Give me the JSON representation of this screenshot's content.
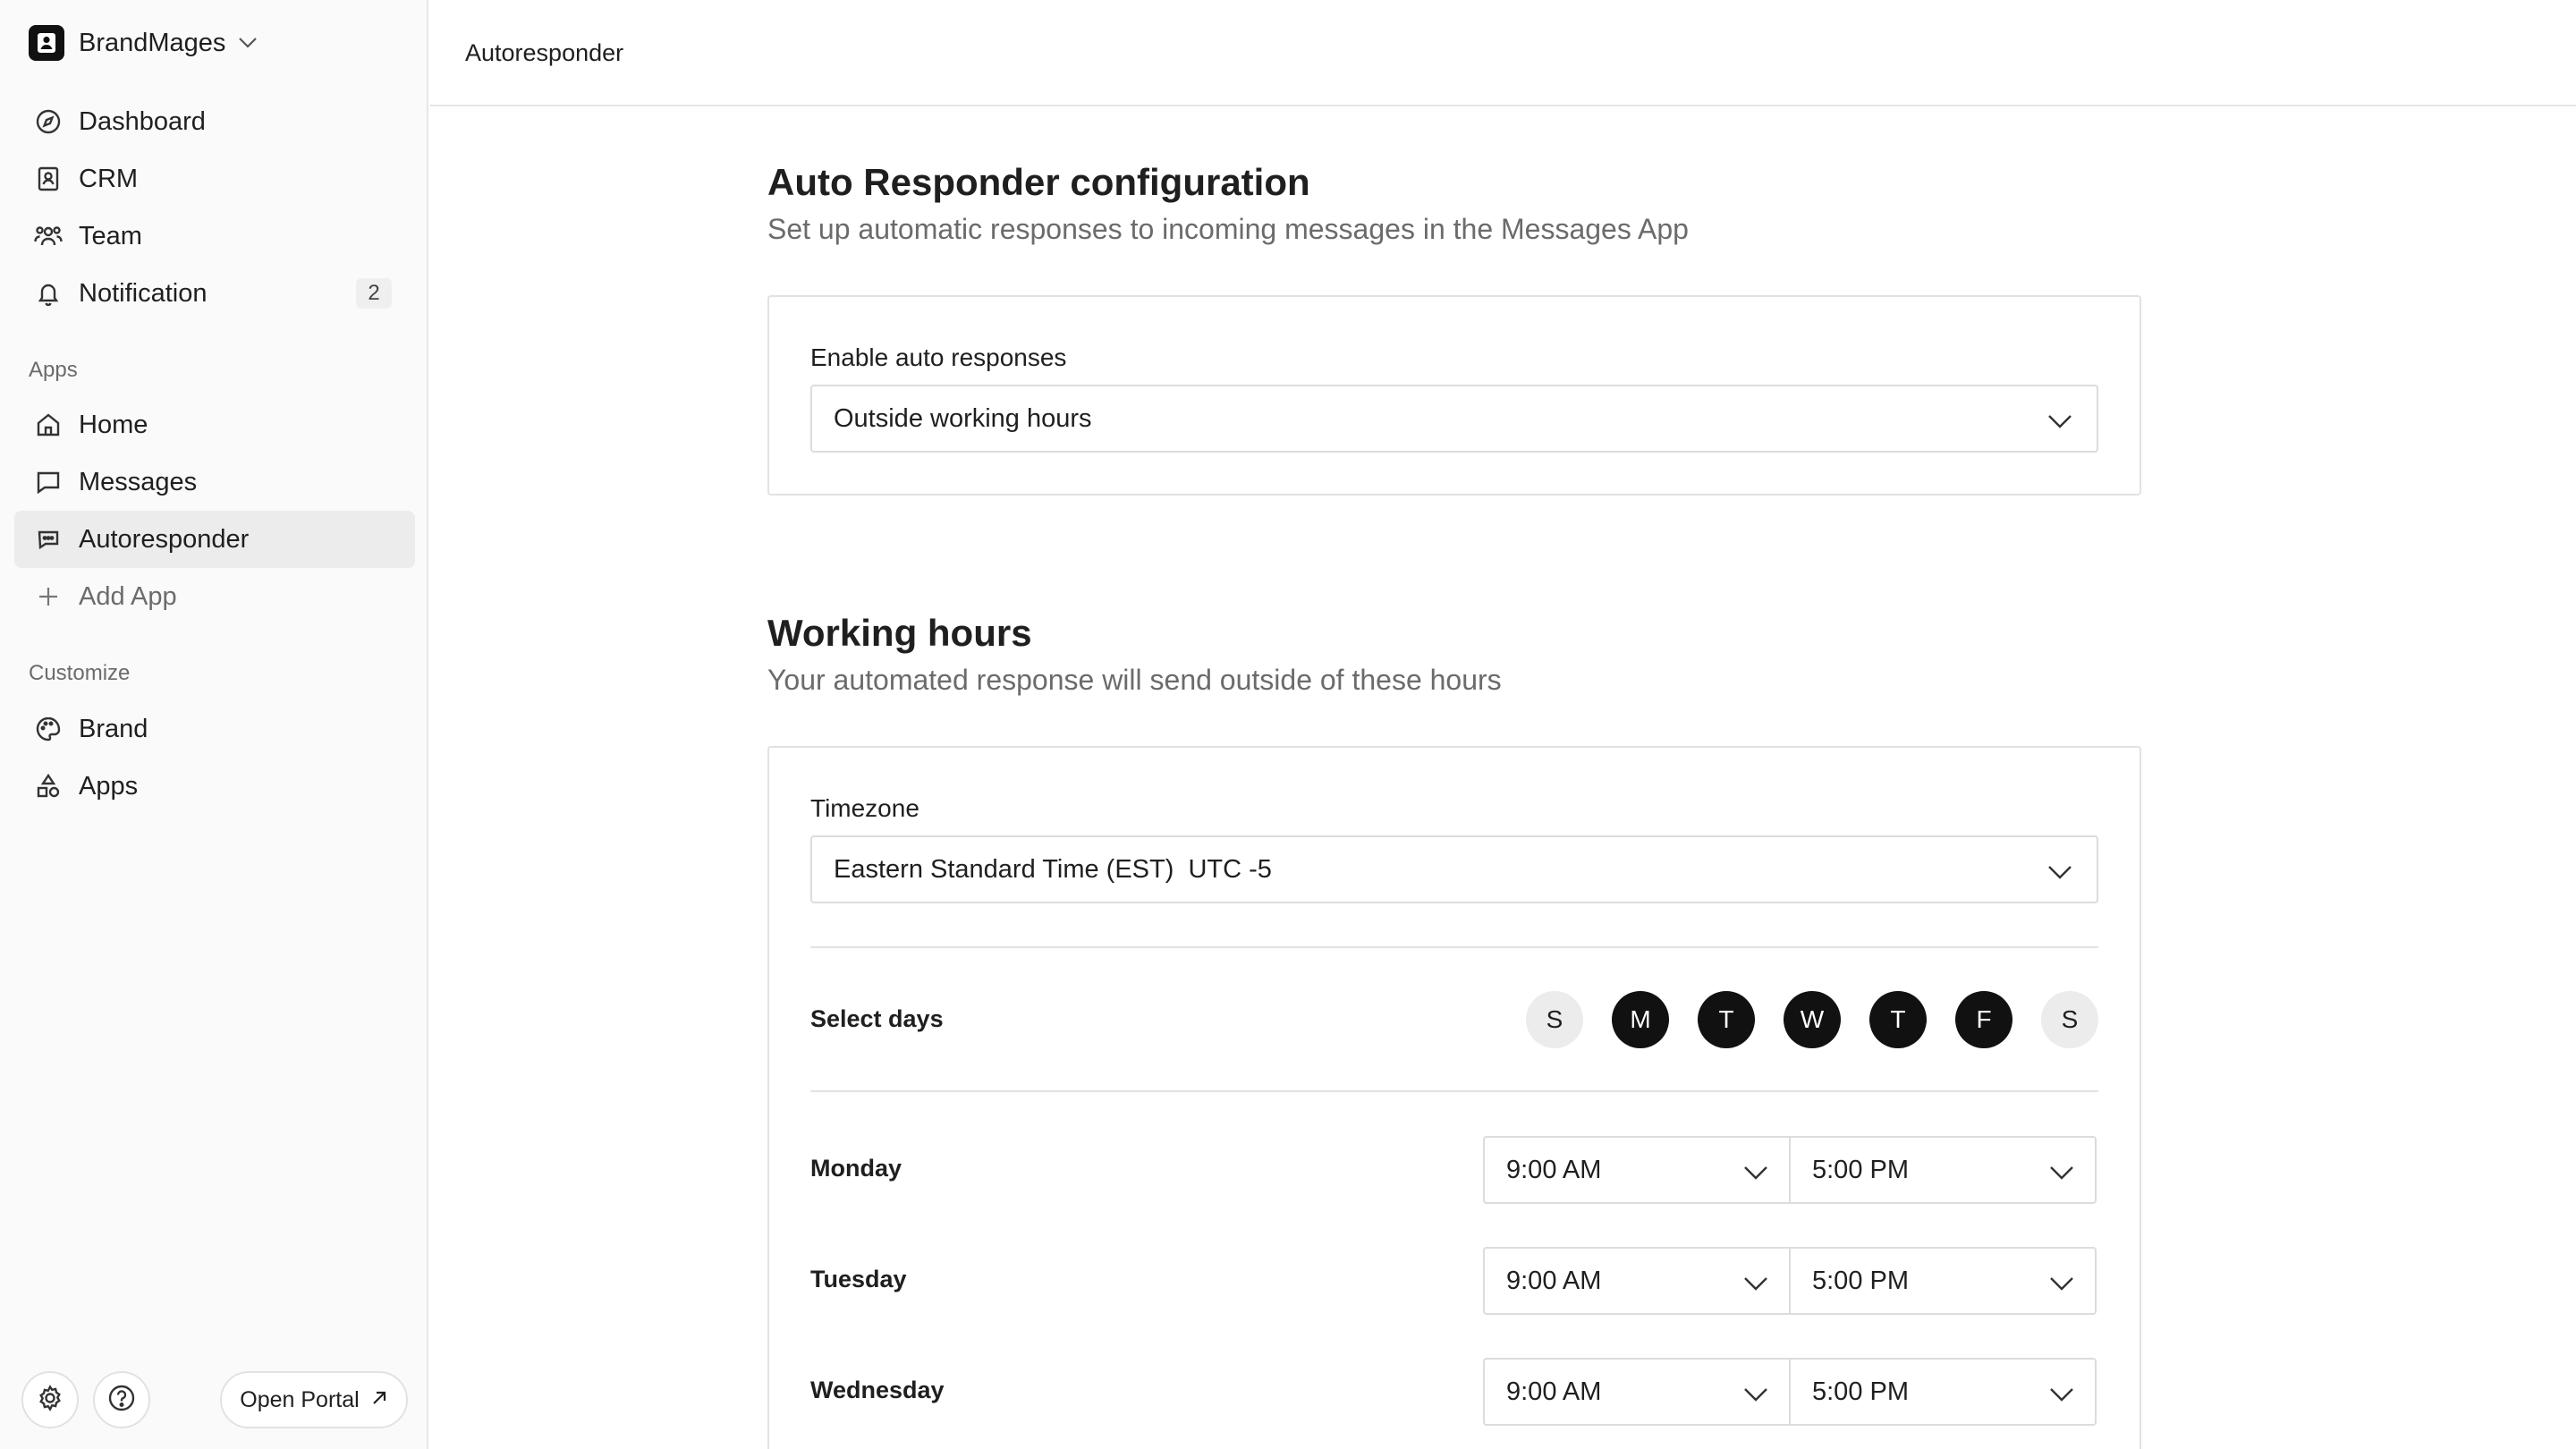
{
  "sidebar": {
    "brand": "BrandMages",
    "nav": [
      {
        "label": "Dashboard",
        "icon": "compass-icon"
      },
      {
        "label": "CRM",
        "icon": "contact-book-icon"
      },
      {
        "label": "Team",
        "icon": "team-icon"
      },
      {
        "label": "Notification",
        "icon": "bell-icon",
        "badge": "2"
      }
    ],
    "apps_title": "Apps",
    "apps": [
      {
        "label": "Home",
        "icon": "home-icon"
      },
      {
        "label": "Messages",
        "icon": "message-icon"
      },
      {
        "label": "Autoresponder",
        "icon": "autoresponder-icon",
        "active": true
      },
      {
        "label": "Add App",
        "icon": "plus-icon"
      }
    ],
    "customize_title": "Customize",
    "customize": [
      {
        "label": "Brand",
        "icon": "palette-icon"
      },
      {
        "label": "Apps",
        "icon": "shapes-icon"
      }
    ],
    "open_portal": "Open Portal"
  },
  "header": {
    "title": "Autoresponder"
  },
  "config": {
    "title": "Auto Responder configuration",
    "subtitle": "Set up automatic responses to incoming messages in the Messages App",
    "enable_label": "Enable auto responses",
    "enable_value": "Outside working hours"
  },
  "hours": {
    "title": "Working hours",
    "subtitle": "Your automated response will send outside of these hours",
    "timezone_label": "Timezone",
    "timezone_value": "Eastern Standard Time (EST)  UTC -5",
    "select_days_label": "Select days",
    "days": [
      {
        "letter": "S",
        "selected": false
      },
      {
        "letter": "M",
        "selected": true
      },
      {
        "letter": "T",
        "selected": true
      },
      {
        "letter": "W",
        "selected": true
      },
      {
        "letter": "T",
        "selected": true
      },
      {
        "letter": "F",
        "selected": true
      },
      {
        "letter": "S",
        "selected": false
      }
    ],
    "schedule": [
      {
        "day": "Monday",
        "start": "9:00 AM",
        "end": "5:00 PM"
      },
      {
        "day": "Tuesday",
        "start": "9:00 AM",
        "end": "5:00 PM"
      },
      {
        "day": "Wednesday",
        "start": "9:00 AM",
        "end": "5:00 PM"
      }
    ]
  },
  "colors": {
    "accent": "#111111",
    "sidebar_bg": "#fafafa",
    "active_bg": "#ececec",
    "border": "#e2e2e2",
    "muted_text": "#6b6b6b"
  }
}
